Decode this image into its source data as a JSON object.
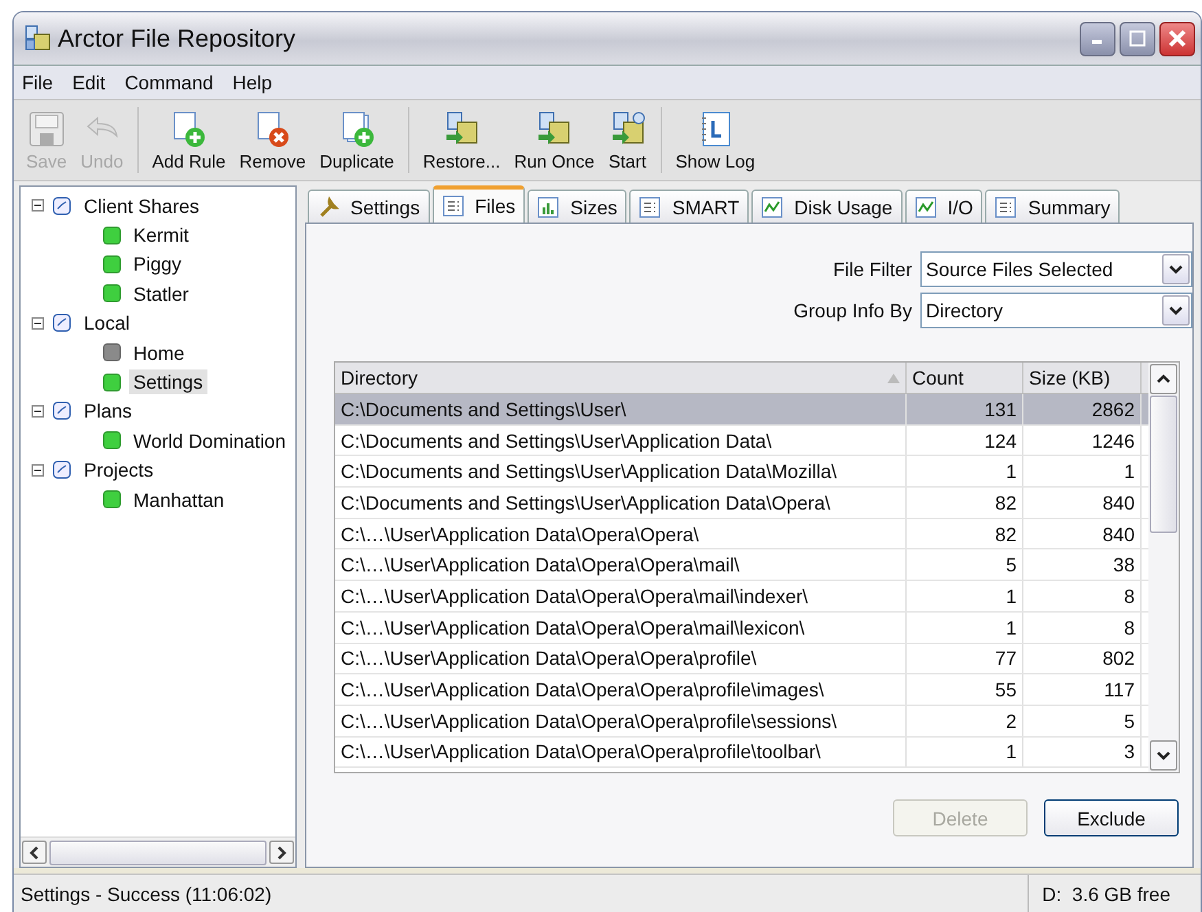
{
  "window": {
    "title": "Arctor File Repository"
  },
  "menu": [
    "File",
    "Edit",
    "Command",
    "Help"
  ],
  "toolbar": {
    "groups": [
      [
        {
          "label": "Save",
          "disabled": true
        },
        {
          "label": "Undo",
          "disabled": true
        }
      ],
      [
        {
          "label": "Add Rule",
          "disabled": false
        },
        {
          "label": "Remove",
          "disabled": false
        },
        {
          "label": "Duplicate",
          "disabled": false
        }
      ],
      [
        {
          "label": "Restore...",
          "disabled": false
        },
        {
          "label": "Run Once",
          "disabled": false
        },
        {
          "label": "Start",
          "disabled": false
        }
      ],
      [
        {
          "label": "Show Log",
          "disabled": false
        }
      ]
    ]
  },
  "tree": [
    {
      "label": "Client Shares",
      "expanded": true,
      "children": [
        {
          "label": "Kermit",
          "color": "#3fcf3f",
          "selected": false
        },
        {
          "label": "Piggy",
          "color": "#3fcf3f",
          "selected": false
        },
        {
          "label": "Statler",
          "color": "#3fcf3f",
          "selected": false
        }
      ]
    },
    {
      "label": "Local",
      "expanded": true,
      "children": [
        {
          "label": "Home",
          "color": "#8a8a8a",
          "selected": false
        },
        {
          "label": "Settings",
          "color": "#3fcf3f",
          "selected": true
        }
      ]
    },
    {
      "label": "Plans",
      "expanded": true,
      "children": [
        {
          "label": "World Domination",
          "color": "#3fcf3f",
          "selected": false
        }
      ]
    },
    {
      "label": "Projects",
      "expanded": true,
      "children": [
        {
          "label": "Manhattan",
          "color": "#3fcf3f",
          "selected": false
        }
      ]
    }
  ],
  "tabs": [
    {
      "label": "Settings",
      "selected": false
    },
    {
      "label": "Files",
      "selected": true
    },
    {
      "label": "Sizes",
      "selected": false
    },
    {
      "label": "SMART",
      "selected": false
    },
    {
      "label": "Disk Usage",
      "selected": false
    },
    {
      "label": "I/O",
      "selected": false
    },
    {
      "label": "Summary",
      "selected": false
    }
  ],
  "filters": [
    {
      "label": "File Filter",
      "value": "Source Files Selected"
    },
    {
      "label": "Group Info By",
      "value": "Directory"
    }
  ],
  "table": {
    "columns": [
      "Directory",
      "Count",
      "Size (KB)"
    ],
    "rows": [
      {
        "cells": [
          "C:\\Documents and Settings\\User\\",
          "131",
          "2862"
        ],
        "selected": true
      },
      {
        "cells": [
          "C:\\Documents and Settings\\User\\Application Data\\",
          "124",
          "1246"
        ],
        "selected": false
      },
      {
        "cells": [
          "C:\\Documents and Settings\\User\\Application Data\\Mozilla\\",
          "1",
          "1"
        ],
        "selected": false
      },
      {
        "cells": [
          "C:\\Documents and Settings\\User\\Application Data\\Opera\\",
          "82",
          "840"
        ],
        "selected": false
      },
      {
        "cells": [
          "C:\\…\\User\\Application Data\\Opera\\Opera\\",
          "82",
          "840"
        ],
        "selected": false
      },
      {
        "cells": [
          "C:\\…\\User\\Application Data\\Opera\\Opera\\mail\\",
          "5",
          "38"
        ],
        "selected": false
      },
      {
        "cells": [
          "C:\\…\\User\\Application Data\\Opera\\Opera\\mail\\indexer\\",
          "1",
          "8"
        ],
        "selected": false
      },
      {
        "cells": [
          "C:\\…\\User\\Application Data\\Opera\\Opera\\mail\\lexicon\\",
          "1",
          "8"
        ],
        "selected": false
      },
      {
        "cells": [
          "C:\\…\\User\\Application Data\\Opera\\Opera\\profile\\",
          "77",
          "802"
        ],
        "selected": false
      },
      {
        "cells": [
          "C:\\…\\User\\Application Data\\Opera\\Opera\\profile\\images\\",
          "55",
          "117"
        ],
        "selected": false
      },
      {
        "cells": [
          "C:\\…\\User\\Application Data\\Opera\\Opera\\profile\\sessions\\",
          "2",
          "5"
        ],
        "selected": false
      },
      {
        "cells": [
          "C:\\…\\User\\Application Data\\Opera\\Opera\\profile\\toolbar\\",
          "1",
          "3"
        ],
        "selected": false
      }
    ]
  },
  "buttons": [
    {
      "label": "Delete",
      "disabled": true
    },
    {
      "label": "Exclude",
      "disabled": false
    }
  ],
  "status_bar": {
    "message": "Settings - Success (11:06:02)",
    "disk": "D:  3.6 GB free"
  }
}
